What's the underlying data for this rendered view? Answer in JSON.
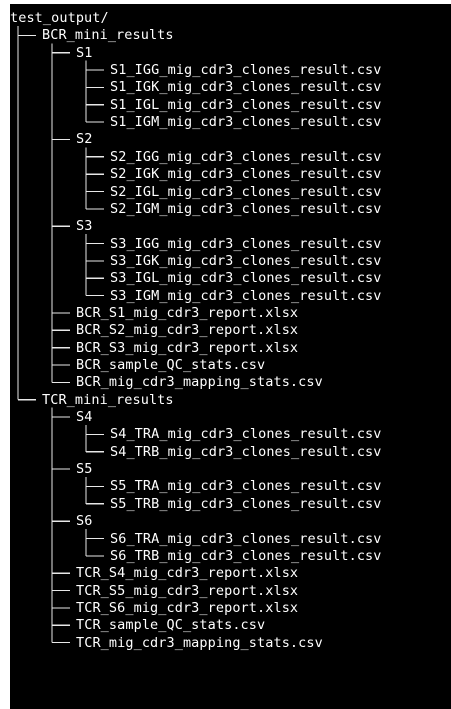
{
  "terminal": {
    "background": "#000000",
    "foreground": "#ffffff"
  },
  "tree": {
    "root": "test_output/",
    "groups": [
      {
        "name": "BCR_mini_results",
        "samples": [
          {
            "name": "S1",
            "files": [
              "S1_IGG_mig_cdr3_clones_result.csv",
              "S1_IGK_mig_cdr3_clones_result.csv",
              "S1_IGL_mig_cdr3_clones_result.csv",
              "S1_IGM_mig_cdr3_clones_result.csv"
            ]
          },
          {
            "name": "S2",
            "files": [
              "S2_IGG_mig_cdr3_clones_result.csv",
              "S2_IGK_mig_cdr3_clones_result.csv",
              "S2_IGL_mig_cdr3_clones_result.csv",
              "S2_IGM_mig_cdr3_clones_result.csv"
            ]
          },
          {
            "name": "S3",
            "files": [
              "S3_IGG_mig_cdr3_clones_result.csv",
              "S3_IGK_mig_cdr3_clones_result.csv",
              "S3_IGL_mig_cdr3_clones_result.csv",
              "S3_IGM_mig_cdr3_clones_result.csv"
            ]
          }
        ],
        "files": [
          "BCR_S1_mig_cdr3_report.xlsx",
          "BCR_S2_mig_cdr3_report.xlsx",
          "BCR_S3_mig_cdr3_report.xlsx",
          "BCR_sample_QC_stats.csv",
          "BCR_mig_cdr3_mapping_stats.csv"
        ]
      },
      {
        "name": "TCR_mini_results",
        "samples": [
          {
            "name": "S4",
            "files": [
              "S4_TRA_mig_cdr3_clones_result.csv",
              "S4_TRB_mig_cdr3_clones_result.csv"
            ]
          },
          {
            "name": "S5",
            "files": [
              "S5_TRA_mig_cdr3_clones_result.csv",
              "S5_TRB_mig_cdr3_clones_result.csv"
            ]
          },
          {
            "name": "S6",
            "files": [
              "S6_TRA_mig_cdr3_clones_result.csv",
              "S6_TRB_mig_cdr3_clones_result.csv"
            ]
          }
        ],
        "files": [
          "TCR_S4_mig_cdr3_report.xlsx",
          "TCR_S5_mig_cdr3_report.xlsx",
          "TCR_S6_mig_cdr3_report.xlsx",
          "TCR_sample_QC_stats.csv",
          "TCR_mig_cdr3_mapping_stats.csv"
        ]
      }
    ]
  }
}
